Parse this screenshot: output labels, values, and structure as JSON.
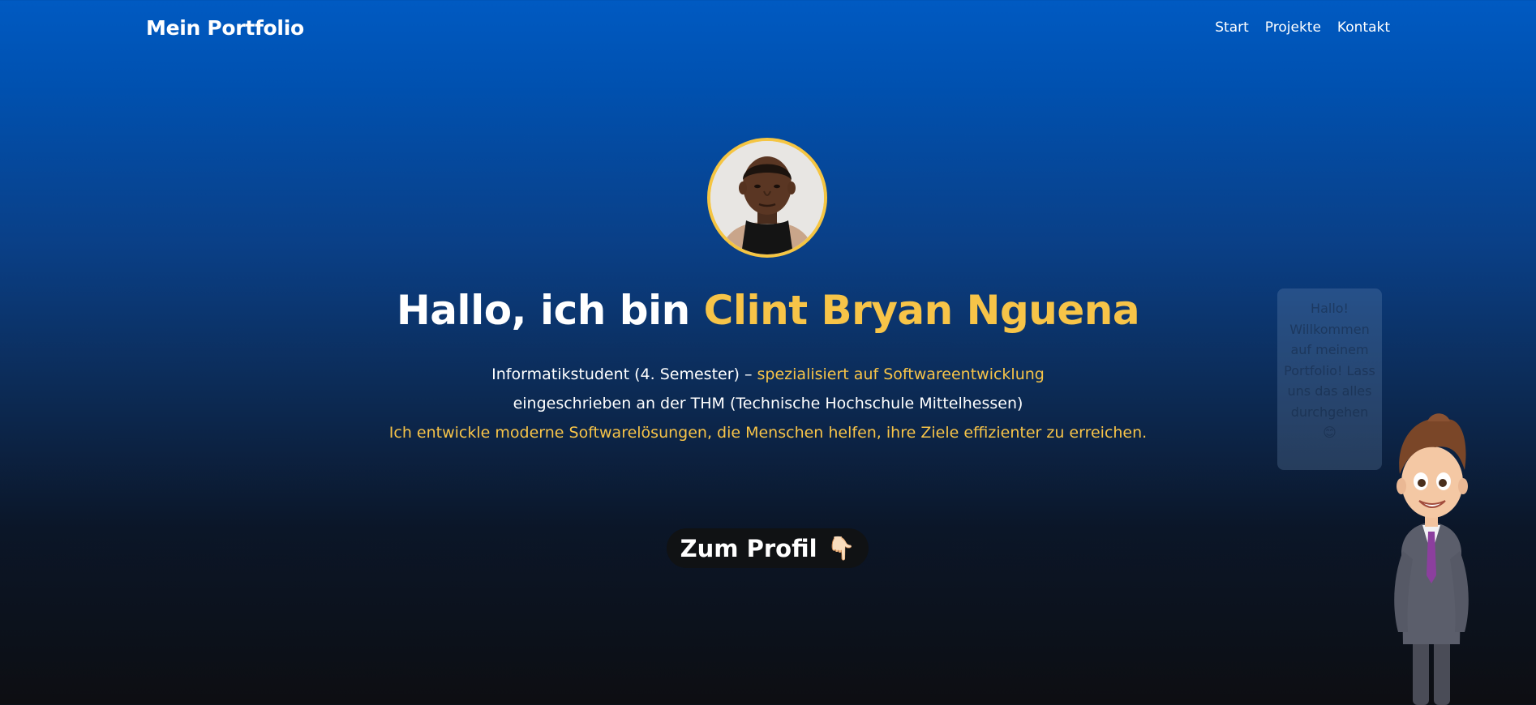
{
  "header": {
    "brand": "Mein Portfolio",
    "nav": [
      "Start",
      "Projekte",
      "Kontakt"
    ]
  },
  "hero": {
    "headline_prefix": "Hallo, ich bin ",
    "headline_name": "Clint Bryan Nguena",
    "line1_prefix": "Informatikstudent (4. Semester) – ",
    "line1_highlight": "spezialisiert auf Softwareentwicklung",
    "line2": "eingeschrieben an der THM (Technische Hochschule Mittelhessen)",
    "line3": "Ich entwickle moderne Softwarelösungen, die Menschen helfen, ihre Ziele effizienter zu erreichen.",
    "cta_label": "Zum Profil",
    "cta_icon": "👇🏻"
  },
  "assistant": {
    "bubble_text": "Hallo! Willkommen auf meinem Portfolio! Lass uns das alles durchgehen 😊"
  },
  "colors": {
    "accent": "#f7c448",
    "gradient_top": "#005ac2",
    "gradient_bottom": "#0d0e12",
    "button_bg": "#101214"
  }
}
